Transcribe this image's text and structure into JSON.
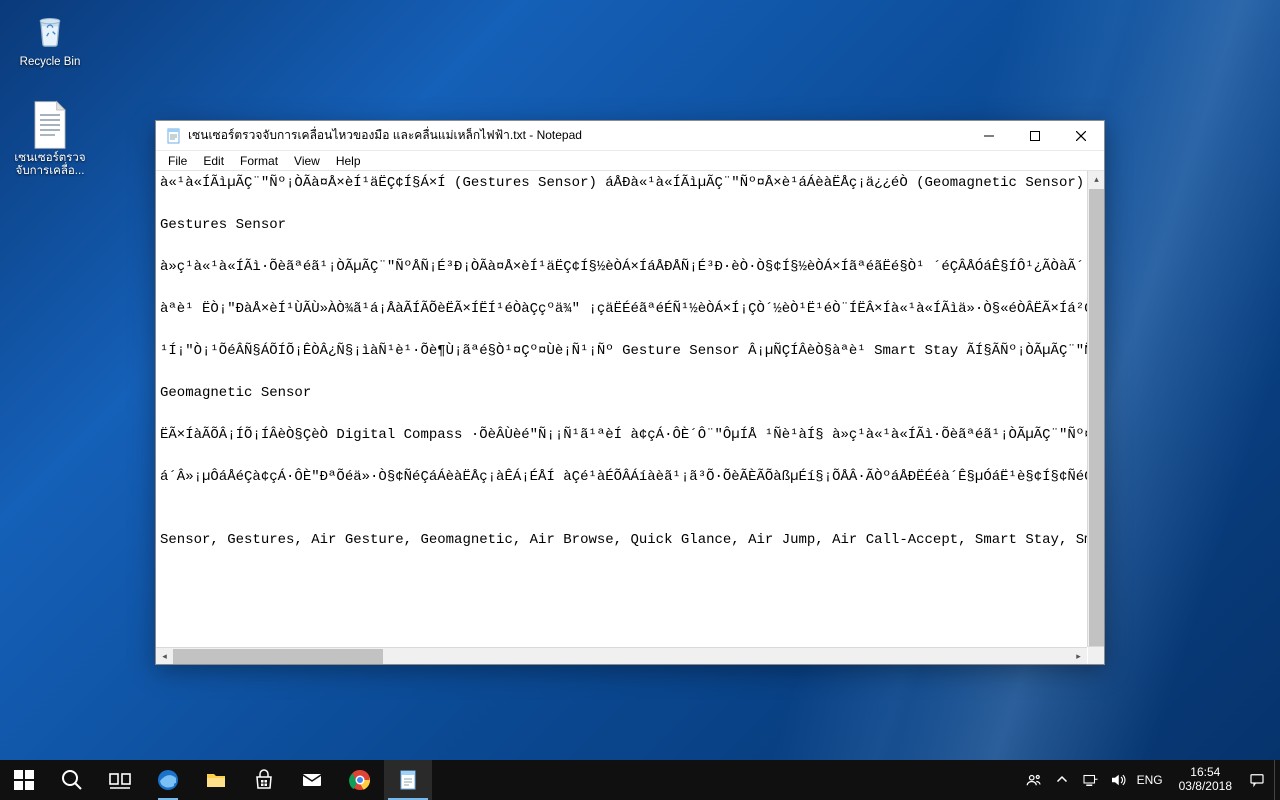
{
  "desktop": {
    "recycle_bin_label": "Recycle Bin",
    "txt_icon_label": "เซนเซอร์ตรวจจับการเคลื่อ..."
  },
  "notepad": {
    "title": "เซนเซอร์ตรวจจับการเคลื่อนไหวของมือ และคลื่นแม่เหล็กไฟฟ้า.txt - Notepad",
    "menu": {
      "file": "File",
      "edit": "Edit",
      "format": "Format",
      "view": "View",
      "help": "Help"
    },
    "content": "à«¹à«ÍÃìµÃÇ¨\"Ñº¡ÒÃà¤Å×èÍ¹äËÇ¢Í§Á×Í (Gestures Sensor) áÅÐà«¹à«ÍÃìµÃÇ¨\"Ñº¤Å×è¹áÁèàËÅç¡ä¿¿éÒ (Geomagnetic Sensor)\n\nGestures Sensor\n\nà»ç¹à«¹à«ÍÃì·Õèãªéã¹¡ÒÃµÃÇ¨\"ÑºÅÑ¡É³Ð¡ÒÃà¤Å×èÍ¹äËÇ¢Í§½èÒÁ×ÍáÅÐÅÑ¡É³Ð·èÒ·Ò§¢Í§½èÒÁ×ÍãªéãËé§Ò¹ ´éÇÂÅÓáÊ§ÍÔ¹¿ÃÒàÃ´·ÕèÍÂÙèºÃÔàÇ³ÇÒà\n\nàªè¹ ËÒ¡\"ÐàÅ×èÍ¹ÙÃÙ»ÀÒ¾ã¹á¡ÅàÃÍÃÕèËÃ×ÍËÍ¹éÒàÇçºä¾\" ¡çäËÉéãªéÉÑ¹½èÒÁ×Í¡ÇÒ´½èÒ¹Ë¹éÒ¨ÍËÂ×Íà«¹à«ÍÃìä»·Ò§«éÒÂËÃ×Íá²ÇÒ (Air\n\n¹Í¡\"Ò¡¹ÕéÂÑ§ÁÕÍÕ¡ÊÒÂ¿Ñ§¡ìàÑ¹è¹·Õè¶Ù¡ãªé§Ò¹¤Çº¤Ùè¡Ñ¹¡Ñº Gesture Sensor Â¡µÑÇÍÂèÒ§àªè¹ Smart Stay ÃÍ§ÃÑº¡ÒÃµÃÇ¨\"ÑºÊÒÂ\n\nGeomagnetic Sensor\n\nËÃ×ÍàÃÕÂ¡ÍÕ¡ÍÂèÒ§ÇèÒ Digital Compass ·ÕèÂÙèé\"Ñ¡¡Ñ¹ã¹ªèÍ à¢çÁ·ÔÈ´Ô¨\"ÔµÍÅ ¹Ñè¹àÍ§ à»ç¹à«¹à«ÍÃì·Õèãªéã¹¡ÒÃµÃÇ¨\"Ñº¤Å×è¹á\n\ná´Â»¡µÔáÅéÇà¢çÁ·ÔÈ\"ÐªÕéä»·Ò§¢ÑéÇáÁèàËÅç¡àÊÁ¡ÉÅÍ àÇé¹àÉÕÂÁíàèã¹¡ã³Õ·ÕèÃÈÃÕàßµÉí§¡ÕÅÂ·ÃÒºáÅÐËÉéà´Ê§µÓáË¹è§¢Í§¢ÑéÇáá¡·Ò§àéá¡·Ò§ÀÙÂÔ\n\n\nSensor, Gestures, Air Gesture, Geomagnetic, Air Browse, Quick Glance, Air Jump, Air Call-Accept, Smart Stay, Smart"
  },
  "taskbar": {
    "lang": "ENG",
    "time": "16:54",
    "date": "03/8/2018"
  }
}
